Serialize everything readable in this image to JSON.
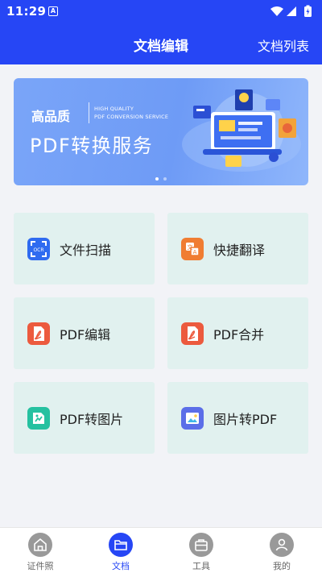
{
  "status": {
    "time": "11:29"
  },
  "header": {
    "title": "文档编辑",
    "right_action": "文档列表"
  },
  "banner": {
    "headline": "高品质",
    "en_line1": "HIGH QUALITY",
    "en_line2": "PDF CONVERSION SERVICE",
    "main_text": "PDF转换服务",
    "pages": 2,
    "active_page": 1
  },
  "features": [
    {
      "label": "文件扫描",
      "icon": "ocr-scan-icon",
      "color": "#2f6bf0"
    },
    {
      "label": "快捷翻译",
      "icon": "translate-icon",
      "color": "#f07d32"
    },
    {
      "label": "PDF编辑",
      "icon": "pdf-file-icon",
      "color": "#ec5a3e"
    },
    {
      "label": "PDF合并",
      "icon": "pdf-file-icon",
      "color": "#ec5a3e"
    },
    {
      "label": "PDF转图片",
      "icon": "image-convert-icon",
      "color": "#25c1a0"
    },
    {
      "label": "图片转PDF",
      "icon": "picture-icon",
      "color": "#5b6ee8"
    }
  ],
  "bottom_nav": [
    {
      "label": "证件照",
      "icon": "home-icon",
      "active": false
    },
    {
      "label": "文档",
      "icon": "folder-icon",
      "active": true
    },
    {
      "label": "工具",
      "icon": "toolbox-icon",
      "active": false
    },
    {
      "label": "我的",
      "icon": "profile-icon",
      "active": false
    }
  ],
  "colors": {
    "primary": "#2646f5",
    "card_bg": "#e1f1ef"
  }
}
